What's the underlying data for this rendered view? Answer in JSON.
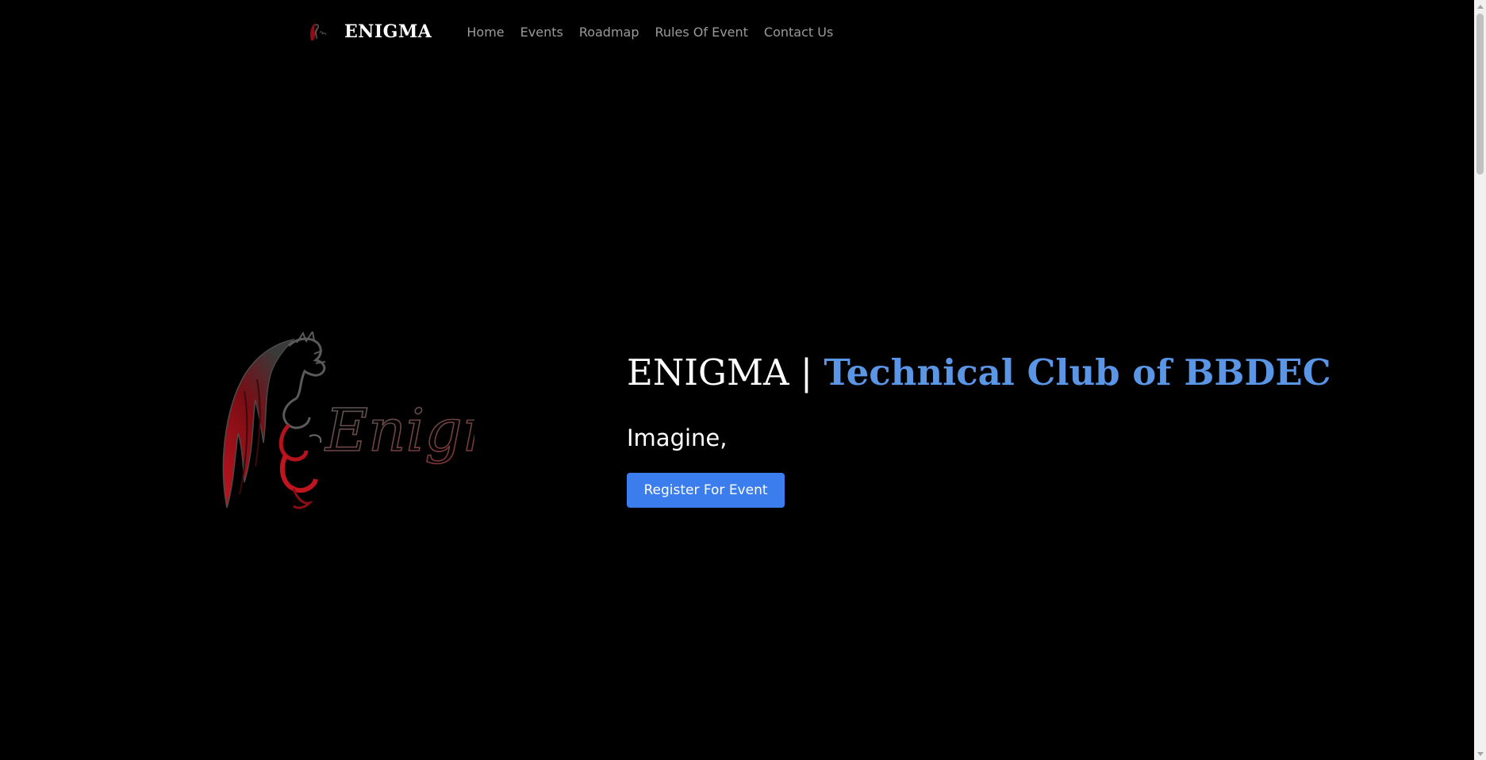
{
  "navbar": {
    "brand": "ENIGMA",
    "logo_icon": "enigma-dragon-logo",
    "links": [
      "Home",
      "Events",
      "Roadmap",
      "Rules Of Event",
      "Contact Us"
    ]
  },
  "hero": {
    "logo_icon": "enigma-dragon-logo",
    "logo_text": "Enigma",
    "title_main": "ENIGMA",
    "title_sep": "|",
    "title_accent": "Technical Club of BBDEC",
    "subtitle": "Imagine,",
    "button_label": "Register For Event"
  },
  "colors": {
    "background": "#000000",
    "accent": "#5a95e6",
    "button": "#3b7ded",
    "nav_link": "#9a9a9a",
    "logo_red": "#b4121c"
  }
}
